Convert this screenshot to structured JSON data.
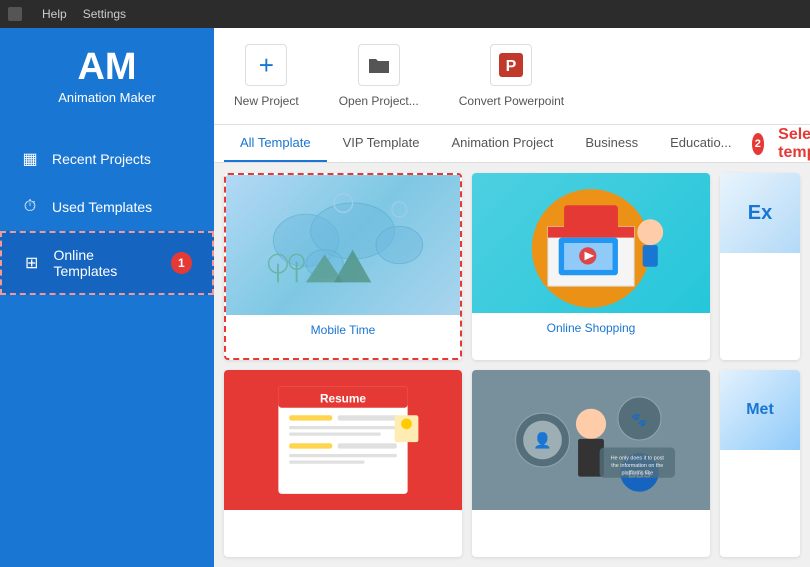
{
  "menubar": {
    "logo_icon": "◼",
    "items": [
      "Help",
      "Settings"
    ]
  },
  "sidebar": {
    "brand_letters": "AM",
    "brand_name": "Animation Maker",
    "nav_items": [
      {
        "id": "recent-projects",
        "label": "Recent Projects",
        "icon": "▦",
        "active": false
      },
      {
        "id": "used-templates",
        "label": "Used Templates",
        "icon": "⏱",
        "active": false
      },
      {
        "id": "online-templates",
        "label": "Online Templates",
        "icon": "⊞",
        "active": true,
        "badge": "1"
      }
    ]
  },
  "action_bar": {
    "buttons": [
      {
        "id": "new-project",
        "icon": "+",
        "label": "New Project"
      },
      {
        "id": "open-project",
        "icon": "📁",
        "label": "Open Project..."
      },
      {
        "id": "convert-powerpoint",
        "icon": "P",
        "label": "Convert Powerpoint"
      }
    ]
  },
  "template_tabs": {
    "badge": "2",
    "select_label": "Select a template",
    "tabs": [
      {
        "id": "all-template",
        "label": "All Template",
        "active": true
      },
      {
        "id": "vip-template",
        "label": "VIP Template",
        "active": false
      },
      {
        "id": "animation-project",
        "label": "Animation Project",
        "active": false
      },
      {
        "id": "business",
        "label": "Business",
        "active": false
      },
      {
        "id": "education",
        "label": "Educatio...",
        "active": false
      }
    ]
  },
  "templates": [
    {
      "id": "mobile-time",
      "label": "Mobile Time",
      "selected": true
    },
    {
      "id": "online-shopping",
      "label": "Online Shopping",
      "selected": false
    },
    {
      "id": "partial-right",
      "label": "Ex...",
      "selected": false
    },
    {
      "id": "resume",
      "label": "",
      "selected": false
    },
    {
      "id": "social-media",
      "label": "",
      "selected": false
    },
    {
      "id": "partial-right-bottom",
      "label": "Met...",
      "selected": false
    }
  ]
}
